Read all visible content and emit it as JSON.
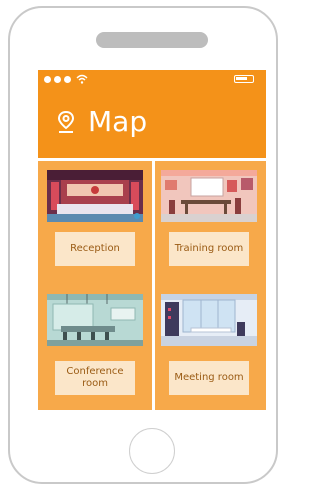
{
  "app": {
    "title": "Map"
  },
  "status_bar": {
    "signal_icon": "signal-dots-icon",
    "wifi_icon": "wifi-icon",
    "battery_icon": "battery-icon"
  },
  "header": {
    "icon": "location-pin-icon",
    "title": "Map"
  },
  "rooms": [
    {
      "label": "Reception",
      "icon": "reception-illustration"
    },
    {
      "label": "Training room",
      "icon": "training-room-illustration"
    },
    {
      "label": "Conference room",
      "icon": "conference-room-illustration"
    },
    {
      "label": "Meeting room",
      "icon": "meeting-room-illustration"
    }
  ],
  "colors": {
    "header": "#f49219",
    "panel": "#f7a94a",
    "label_bg": "#fbe6c9",
    "label_text": "#9a5b14"
  }
}
